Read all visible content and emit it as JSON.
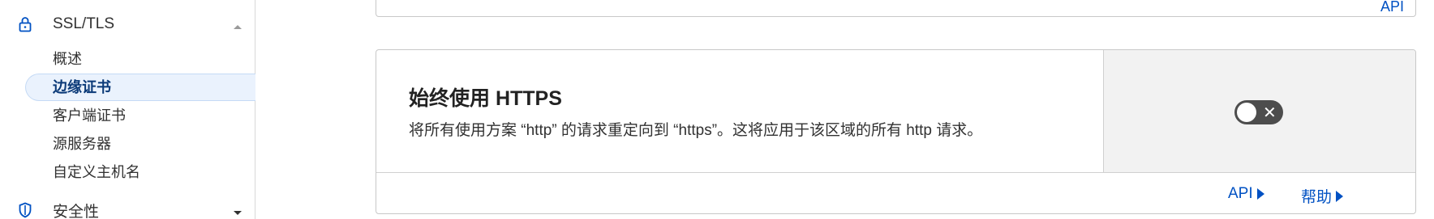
{
  "sidebar": {
    "ssl_section": {
      "label": "SSL/TLS",
      "icon": "lock-icon",
      "expanded": true
    },
    "items": [
      {
        "label": "概述",
        "active": false
      },
      {
        "label": "边缘证书",
        "active": true
      },
      {
        "label": "客户端证书",
        "active": false
      },
      {
        "label": "源服务器",
        "active": false
      },
      {
        "label": "自定义主机名",
        "active": false
      }
    ],
    "security_section": {
      "label": "安全性",
      "icon": "shield-icon",
      "expanded": false
    }
  },
  "top_card": {
    "api_link": "API"
  },
  "https_card": {
    "title": "始终使用 HTTPS",
    "description": "将所有使用方案 “http” 的请求重定向到 “https”。这将应用于该区域的所有 http 请求。",
    "toggle_state": "off",
    "footer": {
      "api_link": "API",
      "help_link": "帮助"
    }
  },
  "colors": {
    "accent": "#0051c3",
    "active_nav_text": "#0b3a78",
    "active_nav_bg": "#eaf2fd",
    "toggle_off": "#4d4d4d"
  }
}
